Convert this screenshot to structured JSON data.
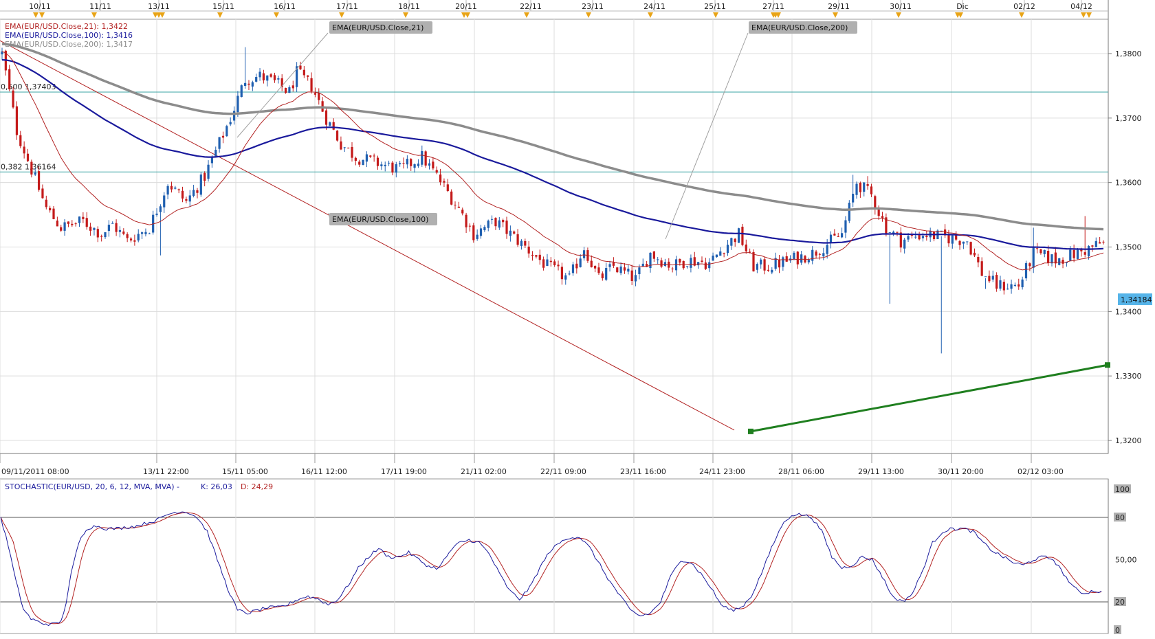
{
  "colors": {
    "ema21": "#b22222",
    "ema100": "#1a1a9c",
    "ema200": "#8c8c8c",
    "bull": "#1f5fb0",
    "bear": "#c41a1a",
    "fib": "#3aa3a3",
    "trend_down": "#b22222",
    "trend_up": "#1f7f1f",
    "stoch_k": "#1a1a9c",
    "stoch_d": "#b22222",
    "grid": "#dcdcdc",
    "price_tag": "#56b4e9",
    "callout_bg": "#b0b0b0"
  },
  "legend": {
    "ema21": "EMA(EUR/USD.Close,21): 1,3422",
    "ema100": "EMA(EUR/USD.Close,100): 1,3416",
    "ema200": "EMA(EUR/USD.Close,200): 1,3417"
  },
  "callouts": {
    "ema21": "EMA(EUR/USD.Close,21)",
    "ema200": "EMA(EUR/USD.Close,200)",
    "ema100": "EMA(EUR/USD.Close,100)"
  },
  "fib_labels": {
    "level_500": "0,500 1,37403",
    "level_382": "0,382 1,36164"
  },
  "price_tag": "1,34184",
  "stochastic": {
    "title": "STOCHASTIC(EUR/USD, 20, 6, 12, MVA, MVA) -",
    "k_label": "K: 26,03",
    "d_label": "D: 24,29"
  },
  "chart_data": [
    {
      "type": "candlestick",
      "title": "",
      "top_dates": [
        "10/11",
        "11/11",
        "13/11",
        "15/11",
        "16/11",
        "17/11",
        "18/11",
        "20/11",
        "22/11",
        "23/11",
        "24/11",
        "25/11",
        "27/11",
        "29/11",
        "30/11",
        "Dic",
        "02/12",
        "04/12"
      ],
      "bottom_dates": [
        "09/11/2011 08:00",
        "13/11 22:00",
        "15/11 05:00",
        "16/11 12:00",
        "17/11 19:00",
        "21/11 02:00",
        "22/11 09:00",
        "23/11 16:00",
        "24/11 23:00",
        "28/11 06:00",
        "29/11 13:00",
        "30/11 20:00",
        "02/12 03:00"
      ],
      "y_ticks": [
        "1,3800",
        "1,3700",
        "1,3600",
        "1,3500",
        "1,3400",
        "1,3300",
        "1,3200"
      ],
      "y_tick_values": [
        1.38,
        1.37,
        1.36,
        1.35,
        1.34,
        1.33,
        1.32
      ],
      "ylim": [
        1.3148,
        1.3855
      ],
      "bar_count": 300,
      "close_path": [
        [
          0,
          1.38
        ],
        [
          4,
          1.368
        ],
        [
          8,
          1.362
        ],
        [
          12,
          1.356
        ],
        [
          16,
          1.353
        ],
        [
          22,
          1.354
        ],
        [
          27,
          1.352
        ],
        [
          30,
          1.3535
        ],
        [
          34,
          1.351
        ],
        [
          40,
          1.353
        ],
        [
          45,
          1.36
        ],
        [
          50,
          1.357
        ],
        [
          55,
          1.361
        ],
        [
          62,
          1.37
        ],
        [
          66,
          1.376
        ],
        [
          70,
          1.3765
        ],
        [
          74,
          1.3755
        ],
        [
          78,
          1.374
        ],
        [
          80,
          1.377
        ],
        [
          84,
          1.375
        ],
        [
          88,
          1.37
        ],
        [
          92,
          1.366
        ],
        [
          96,
          1.364
        ],
        [
          102,
          1.363
        ],
        [
          108,
          1.362
        ],
        [
          114,
          1.364
        ],
        [
          118,
          1.361
        ],
        [
          124,
          1.356
        ],
        [
          128,
          1.352
        ],
        [
          134,
          1.354
        ],
        [
          138,
          1.352
        ],
        [
          142,
          1.35
        ],
        [
          148,
          1.347
        ],
        [
          154,
          1.345
        ],
        [
          158,
          1.35
        ],
        [
          162,
          1.345
        ],
        [
          166,
          1.347
        ],
        [
          172,
          1.345
        ],
        [
          176,
          1.349
        ],
        [
          182,
          1.347
        ],
        [
          186,
          1.348
        ],
        [
          192,
          1.3475
        ],
        [
          196,
          1.35
        ],
        [
          200,
          1.352
        ],
        [
          204,
          1.347
        ],
        [
          208,
          1.347
        ],
        [
          214,
          1.348
        ],
        [
          220,
          1.349
        ],
        [
          228,
          1.352
        ],
        [
          232,
          1.36
        ],
        [
          236,
          1.358
        ],
        [
          240,
          1.353
        ],
        [
          244,
          1.351
        ],
        [
          250,
          1.352
        ],
        [
          256,
          1.3515
        ],
        [
          262,
          1.351
        ],
        [
          266,
          1.346
        ],
        [
          270,
          1.344
        ],
        [
          276,
          1.344
        ],
        [
          280,
          1.349
        ],
        [
          286,
          1.348
        ],
        [
          292,
          1.349
        ],
        [
          298,
          1.3505
        ]
      ],
      "ema21_end": 1.3422,
      "ema100_end": 1.3416,
      "ema200_end": 1.3417,
      "last_price": 1.34184,
      "fib_levels": [
        {
          "ratio": 0.5,
          "price": 1.37403
        },
        {
          "ratio": 0.382,
          "price": 1.36164
        }
      ]
    },
    {
      "type": "line",
      "title": "STOCHASTIC(EUR/USD, 20, 6, 12, MVA, MVA)",
      "y_ticks": [
        "100",
        "80",
        "50,00",
        "20",
        "0"
      ],
      "y_tick_values": [
        100,
        80,
        50,
        20,
        0
      ],
      "ylim": [
        0,
        100
      ],
      "series": [
        {
          "name": "K",
          "last": 26.03
        },
        {
          "name": "D",
          "last": 24.29
        }
      ],
      "k_path": [
        [
          0,
          80
        ],
        [
          3,
          60
        ],
        [
          6,
          35
        ],
        [
          9,
          15
        ],
        [
          12,
          8
        ],
        [
          16,
          5
        ],
        [
          20,
          4
        ],
        [
          24,
          6
        ],
        [
          26,
          20
        ],
        [
          28,
          40
        ],
        [
          31,
          62
        ],
        [
          34,
          72
        ],
        [
          38,
          74
        ],
        [
          42,
          72
        ],
        [
          46,
          72
        ],
        [
          50,
          73
        ],
        [
          54,
          74
        ],
        [
          58,
          76
        ],
        [
          62,
          78
        ],
        [
          66,
          82
        ],
        [
          70,
          84
        ],
        [
          74,
          84
        ],
        [
          78,
          80
        ],
        [
          82,
          70
        ],
        [
          86,
          50
        ],
        [
          90,
          30
        ],
        [
          94,
          14
        ],
        [
          98,
          12
        ],
        [
          102,
          14
        ],
        [
          106,
          16
        ],
        [
          110,
          16
        ],
        [
          114,
          18
        ],
        [
          118,
          22
        ],
        [
          122,
          24
        ],
        [
          126,
          22
        ],
        [
          130,
          18
        ],
        [
          134,
          22
        ],
        [
          138,
          32
        ],
        [
          142,
          44
        ],
        [
          146,
          52
        ],
        [
          150,
          58
        ],
        [
          154,
          52
        ],
        [
          158,
          52
        ],
        [
          162,
          55
        ],
        [
          166,
          50
        ],
        [
          170,
          45
        ],
        [
          174,
          44
        ],
        [
          178,
          55
        ],
        [
          182,
          62
        ],
        [
          186,
          64
        ],
        [
          190,
          62
        ],
        [
          194,
          54
        ],
        [
          198,
          40
        ],
        [
          202,
          28
        ],
        [
          206,
          22
        ],
        [
          210,
          30
        ],
        [
          214,
          44
        ],
        [
          218,
          56
        ],
        [
          222,
          62
        ],
        [
          226,
          66
        ],
        [
          230,
          66
        ],
        [
          234,
          58
        ],
        [
          238,
          46
        ],
        [
          242,
          34
        ],
        [
          246,
          24
        ],
        [
          250,
          14
        ],
        [
          254,
          10
        ],
        [
          258,
          12
        ],
        [
          262,
          20
        ],
        [
          266,
          38
        ],
        [
          270,
          50
        ],
        [
          274,
          48
        ],
        [
          278,
          40
        ],
        [
          282,
          30
        ],
        [
          286,
          18
        ],
        [
          290,
          14
        ],
        [
          294,
          16
        ],
        [
          298,
          24
        ],
        [
          302,
          40
        ],
        [
          306,
          58
        ],
        [
          310,
          74
        ],
        [
          314,
          82
        ],
        [
          318,
          82
        ],
        [
          322,
          80
        ],
        [
          326,
          70
        ],
        [
          330,
          52
        ],
        [
          334,
          44
        ],
        [
          338,
          46
        ],
        [
          342,
          52
        ],
        [
          346,
          50
        ],
        [
          350,
          38
        ],
        [
          354,
          24
        ],
        [
          358,
          20
        ],
        [
          362,
          26
        ],
        [
          366,
          42
        ],
        [
          370,
          62
        ],
        [
          374,
          70
        ],
        [
          378,
          72
        ],
        [
          382,
          72
        ],
        [
          386,
          70
        ],
        [
          390,
          62
        ],
        [
          394,
          56
        ],
        [
          398,
          52
        ],
        [
          402,
          48
        ],
        [
          406,
          46
        ],
        [
          410,
          50
        ],
        [
          414,
          52
        ],
        [
          418,
          50
        ],
        [
          422,
          40
        ],
        [
          426,
          30
        ],
        [
          430,
          26
        ],
        [
          434,
          28
        ],
        [
          437,
          27
        ]
      ]
    }
  ]
}
